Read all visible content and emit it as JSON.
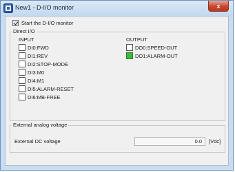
{
  "window": {
    "title": "New1 - D-I/O monitor",
    "close_glyph": "x",
    "app_icon": "app-icon"
  },
  "start_monitor": {
    "label": "Start the D-I/O monitor",
    "checked": true
  },
  "direct_io": {
    "label": "Direct I/O",
    "input_header": "INPUT",
    "output_header": "OUTPUT",
    "inputs": [
      {
        "label": "DI0:FWD",
        "on": false
      },
      {
        "label": "DI1:REV",
        "on": false
      },
      {
        "label": "DI2:STOP-MODE",
        "on": false
      },
      {
        "label": "DI3:M0",
        "on": false
      },
      {
        "label": "DI4:M1",
        "on": false
      },
      {
        "label": "DI5:ALARM-RESET",
        "on": false
      },
      {
        "label": "DI6:MB-FREE",
        "on": false
      }
    ],
    "outputs": [
      {
        "label": "DO0:SPEED-OUT",
        "on": false
      },
      {
        "label": "DO1:ALARM-OUT",
        "on": true
      }
    ]
  },
  "analog": {
    "label": "External analog voltage",
    "field_label": "External DC voltage",
    "value": "0.0",
    "unit": "[Vdc]"
  },
  "colors": {
    "active_indicator": "#3dbb3d",
    "close_button": "#c9462f"
  }
}
